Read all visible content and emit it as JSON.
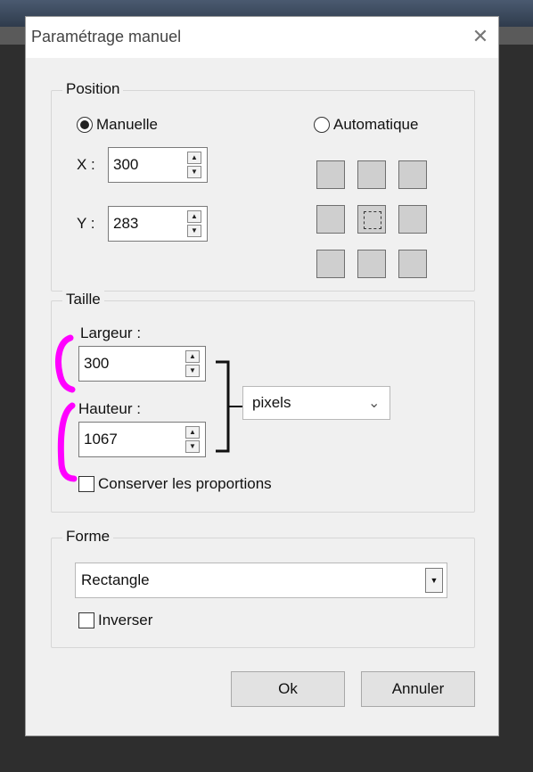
{
  "dialog": {
    "title": "Paramétrage manuel",
    "close_label": "✕"
  },
  "position": {
    "group_label": "Position",
    "manual_label": "Manuelle",
    "auto_label": "Automatique",
    "manual_selected": true,
    "x_label": "X :",
    "x_value": "300",
    "y_label": "Y :",
    "y_value": "283",
    "anchor_grid": [
      "top-left",
      "top-center",
      "top-right",
      "middle-left",
      "center",
      "middle-right",
      "bottom-left",
      "bottom-center",
      "bottom-right"
    ],
    "anchor_selected": "center"
  },
  "size": {
    "group_label": "Taille",
    "width_label": "Largeur :",
    "width_value": "300",
    "height_label": "Hauteur :",
    "height_value": "1067",
    "unit_value": "pixels",
    "keep_ratio_label": "Conserver les proportions",
    "keep_ratio_checked": false
  },
  "shape": {
    "group_label": "Forme",
    "shape_value": "Rectangle",
    "invert_label": "Inverser",
    "invert_checked": false
  },
  "buttons": {
    "ok": "Ok",
    "cancel": "Annuler"
  },
  "colors": {
    "highlight": "#ff00ff"
  }
}
